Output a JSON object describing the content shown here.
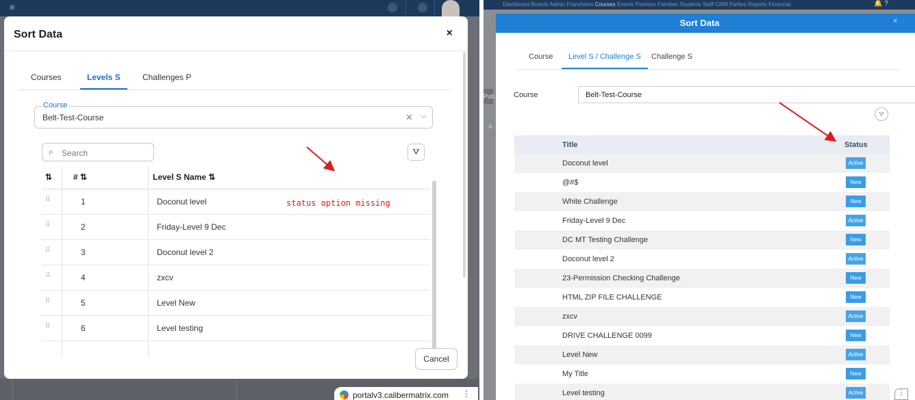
{
  "left": {
    "modal_title": "Sort Data",
    "close_label": "×",
    "tabs": [
      {
        "label": "Courses"
      },
      {
        "label": "Levels S"
      },
      {
        "label": "Challenges P"
      }
    ],
    "course_field": {
      "legend": "Course",
      "value": "Belt-Test-Course",
      "clear_label": "✕",
      "chevron_label": "⌵"
    },
    "search": {
      "placeholder": "Search"
    },
    "table": {
      "headers": {
        "sort": "⇅",
        "number": "# ⇅",
        "name": "Level S Name ⇅"
      },
      "rows": [
        {
          "num": "1",
          "name": "Doconut level"
        },
        {
          "num": "2",
          "name": "Friday-Level 9 Dec"
        },
        {
          "num": "3",
          "name": "Doconut level 2"
        },
        {
          "num": "4",
          "name": "zxcv"
        },
        {
          "num": "5",
          "name": "Level New"
        },
        {
          "num": "6",
          "name": "Level testing"
        }
      ]
    },
    "annotation": "status option missing",
    "cancel_label": "Cancel",
    "browser_url": "portalv3.calibermatrix.com"
  },
  "right": {
    "nav_links": [
      "Dashboard",
      "Boards",
      "Admin",
      "Franchises",
      "Courses",
      "Events",
      "Partners",
      "Families",
      "Students",
      "Staff",
      "CRM",
      "Parties",
      "Reports",
      "Financial"
    ],
    "nav_active": "Courses",
    "modal_title": "Sort Data",
    "close_label": "×",
    "side_label": "Pub",
    "side_label2": "A",
    "tabs": [
      {
        "label": "Course"
      },
      {
        "label": "Level S / Challenge S"
      },
      {
        "label": "Challenge S"
      }
    ],
    "course_label": "Course",
    "course_value": "Belt-Test-Course",
    "table": {
      "headers": {
        "title": "Title",
        "status": "Status"
      },
      "rows": [
        {
          "title": "Doconut level",
          "status": "Active"
        },
        {
          "title": "@#$",
          "status": "New"
        },
        {
          "title": "White Challenge",
          "status": "New"
        },
        {
          "title": "Friday-Level 9 Dec",
          "status": "Active"
        },
        {
          "title": "DC MT Testing Challenge",
          "status": "New"
        },
        {
          "title": "Doconut level 2",
          "status": "Active"
        },
        {
          "title": "23-Permission Checking Challenge",
          "status": "New"
        },
        {
          "title": "HTML ZIP FILE CHALLENGE",
          "status": "New"
        },
        {
          "title": "zxcv",
          "status": "Active"
        },
        {
          "title": "DRIVE CHALLENGE 0099",
          "status": "New"
        },
        {
          "title": "Level New",
          "status": "Active"
        },
        {
          "title": "My Title",
          "status": "New"
        },
        {
          "title": "Level testing",
          "status": "Active"
        }
      ]
    }
  },
  "colors": {
    "brand_blue": "#1f80d6",
    "annotation_red": "#e01b1b",
    "topbar": "#1d3a5c"
  }
}
